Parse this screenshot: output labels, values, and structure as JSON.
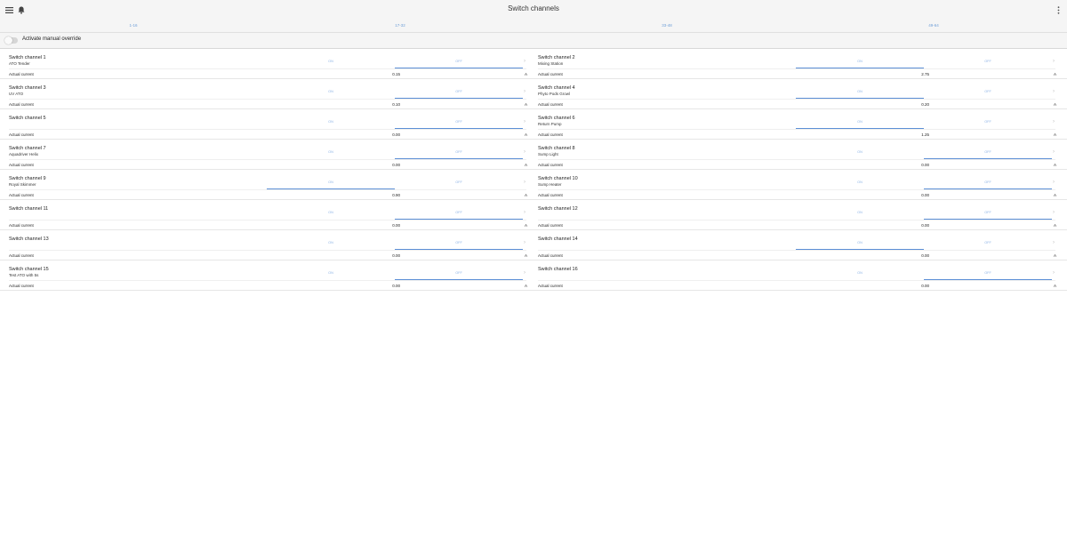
{
  "header": {
    "title": "Switch channels"
  },
  "tabs": [
    {
      "label": "1-16",
      "active": true
    },
    {
      "label": "17-32",
      "active": false
    },
    {
      "label": "33-48",
      "active": false
    },
    {
      "label": "49-64",
      "active": false
    }
  ],
  "override": {
    "label": "Activate manual override",
    "enabled": false
  },
  "common": {
    "on_label": "ON",
    "off_label": "OFF",
    "current_label": "Actual current",
    "unit": "A"
  },
  "channels": [
    {
      "name": "Switch channel 1",
      "description": "ATO Tender",
      "state": "OFF",
      "current": "0.15"
    },
    {
      "name": "Switch channel 2",
      "description": "Mixing Station",
      "state": "ON",
      "current": "2.75"
    },
    {
      "name": "Switch channel 3",
      "description": "UV ATO",
      "state": "OFF",
      "current": "0.10"
    },
    {
      "name": "Switch channel 4",
      "description": "Phyto Pods Growl",
      "state": "ON",
      "current": "0.20"
    },
    {
      "name": "Switch channel 5",
      "description": "",
      "state": "OFF",
      "current": "0.00"
    },
    {
      "name": "Switch channel 6",
      "description": "Return Pump",
      "state": "ON",
      "current": "1.25"
    },
    {
      "name": "Switch channel 7",
      "description": "Aquadriver Helix",
      "state": "OFF",
      "current": "0.00"
    },
    {
      "name": "Switch channel 8",
      "description": "Sump Light",
      "state": "OFF",
      "current": "0.00"
    },
    {
      "name": "Switch channel 9",
      "description": "Royal Skimmer",
      "state": "ON",
      "current": "0.90"
    },
    {
      "name": "Switch channel 10",
      "description": "Sump Heater",
      "state": "OFF",
      "current": "0.00"
    },
    {
      "name": "Switch channel 11",
      "description": "",
      "state": "OFF",
      "current": "0.00"
    },
    {
      "name": "Switch channel 12",
      "description": "",
      "state": "OFF",
      "current": "0.00"
    },
    {
      "name": "Switch channel 13",
      "description": "",
      "state": "OFF",
      "current": "0.00"
    },
    {
      "name": "Switch channel 14",
      "description": "",
      "state": "ON",
      "current": "0.00"
    },
    {
      "name": "Switch channel 15",
      "description": "Test ATO with 5s",
      "state": "OFF",
      "current": "0.00"
    },
    {
      "name": "Switch channel 16",
      "description": "",
      "state": "OFF",
      "current": "0.00"
    }
  ]
}
